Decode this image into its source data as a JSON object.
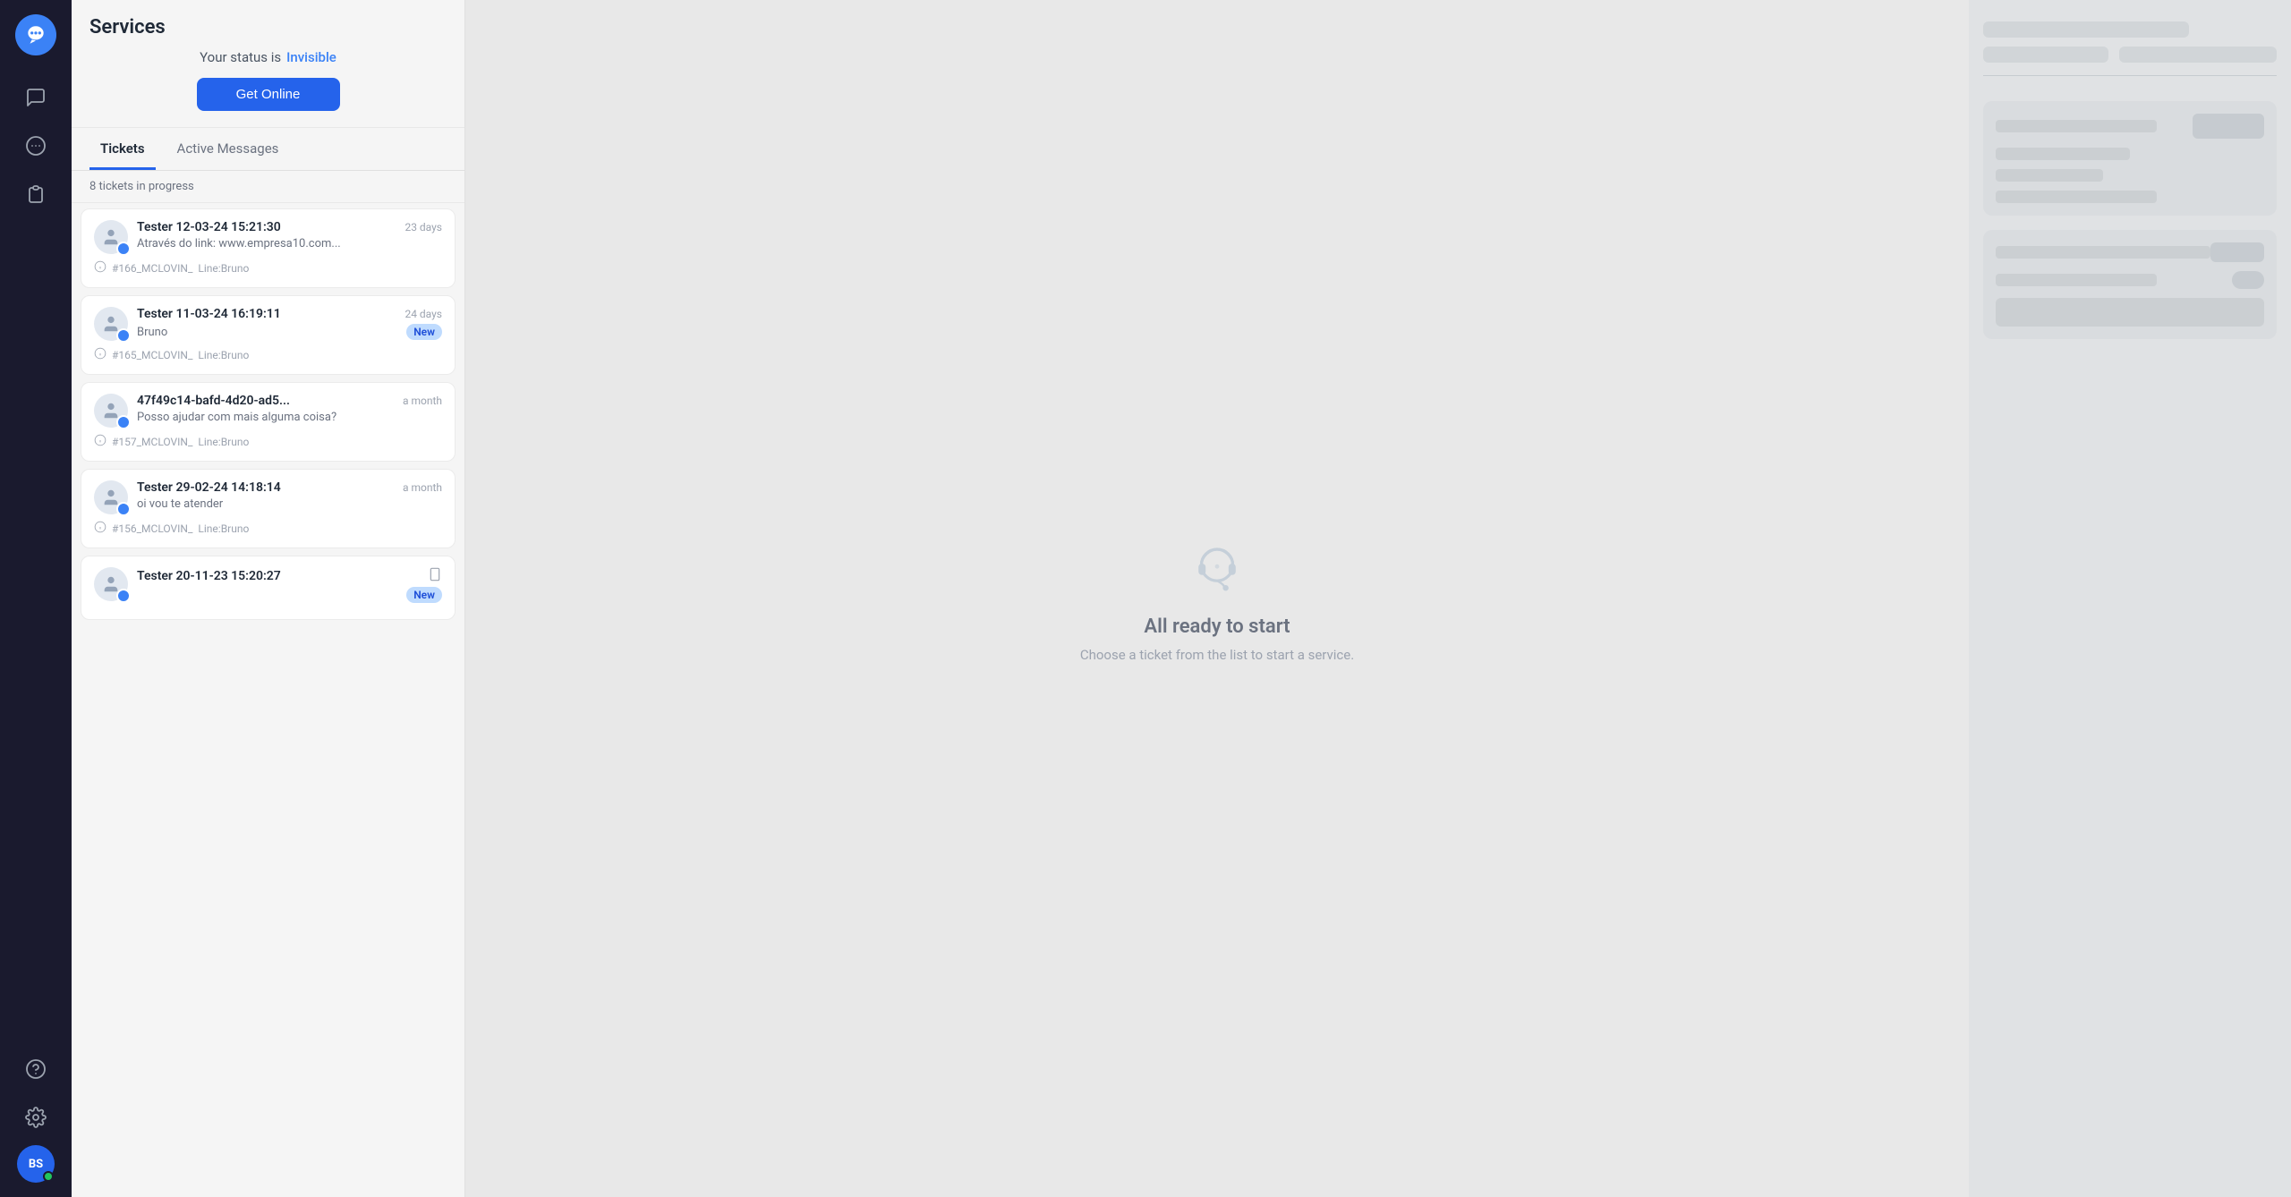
{
  "sidebar": {
    "logo_label": "Chat App",
    "items": [
      {
        "id": "chat",
        "label": "Chat",
        "icon": "chat-icon"
      },
      {
        "id": "messages",
        "label": "Messages",
        "icon": "messages-icon"
      },
      {
        "id": "contacts",
        "label": "Contacts",
        "icon": "contacts-icon"
      }
    ],
    "bottom_items": [
      {
        "id": "help",
        "label": "Help",
        "icon": "help-icon"
      },
      {
        "id": "settings",
        "label": "Settings",
        "icon": "settings-icon"
      }
    ],
    "avatar": {
      "initials": "BS",
      "online": true
    }
  },
  "ticket_panel": {
    "title": "Services",
    "status_text": "Your status is",
    "status_value": "Invisible",
    "get_online_label": "Get Online",
    "tabs": [
      {
        "id": "tickets",
        "label": "Tickets",
        "active": true
      },
      {
        "id": "active_messages",
        "label": "Active Messages",
        "active": false
      }
    ],
    "in_progress_label": "8 tickets in progress",
    "tickets": [
      {
        "id": "ticket-166",
        "name": "Tester 12-03-24 15:21:30",
        "age": "23 days",
        "message": "Através do link: www.empresa10.com...",
        "ticket_id": "#166_MCLOVIN_",
        "line": "Line:Bruno",
        "badge": null
      },
      {
        "id": "ticket-165",
        "name": "Tester 11-03-24 16:19:11",
        "age": "24 days",
        "message": "Bruno",
        "ticket_id": "#165_MCLOVIN_",
        "line": "Line:Bruno",
        "badge": "New"
      },
      {
        "id": "ticket-157",
        "name": "47f49c14-bafd-4d20-ad5...",
        "age": "a month",
        "message": "Posso ajudar com mais alguma coisa?",
        "ticket_id": "#157_MCLOVIN_",
        "line": "Line:Bruno",
        "badge": null
      },
      {
        "id": "ticket-156",
        "name": "Tester 29-02-24 14:18:14",
        "age": "a month",
        "message": "oi vou te atender",
        "ticket_id": "#156_MCLOVIN_",
        "line": "Line:Bruno",
        "badge": null
      },
      {
        "id": "ticket-155",
        "name": "Tester 20-11-23 15:20:27",
        "age": "",
        "message": "",
        "ticket_id": "",
        "line": "",
        "badge": "New"
      }
    ]
  },
  "main": {
    "empty_title": "All ready to start",
    "empty_subtitle": "Choose a ticket from the list to start a service."
  }
}
